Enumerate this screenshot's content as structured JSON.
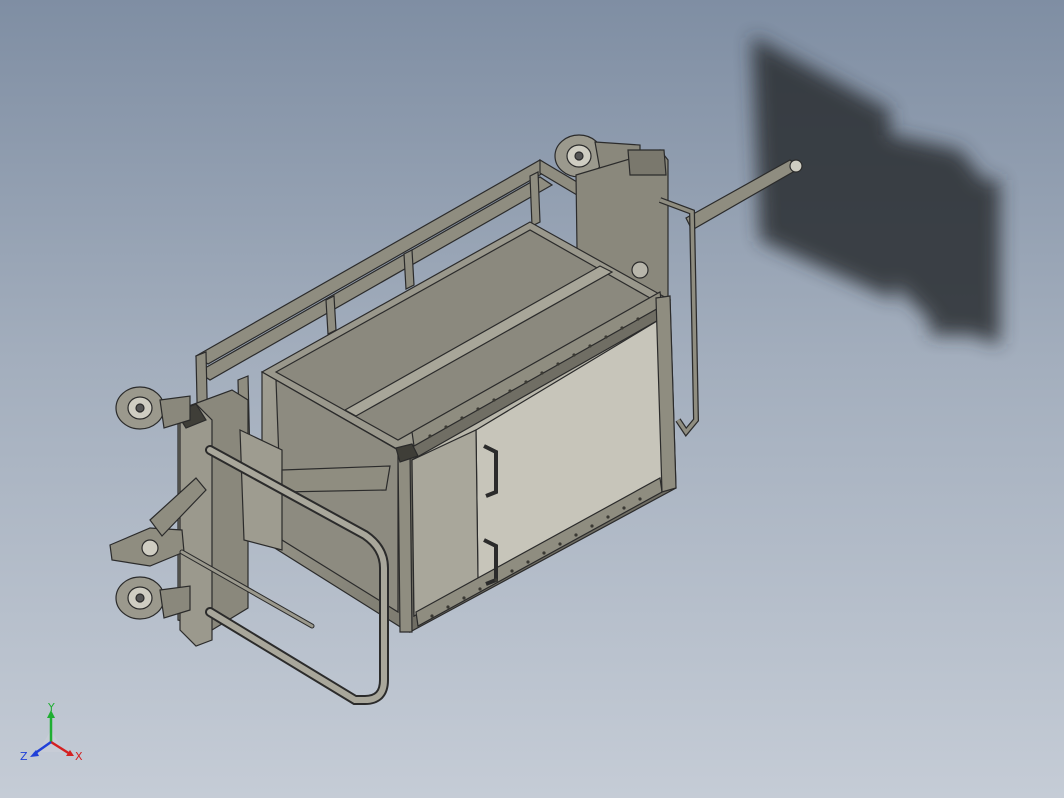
{
  "viewport": {
    "background_top": "#7f8ea3",
    "background_bottom": "#c5ccd6"
  },
  "model": {
    "body_color": "#8f8d80",
    "edge_color": "#2b2b2b",
    "interior_color": "#b7b5aa",
    "shadow_color": "#2a2d33"
  },
  "triad": {
    "x_label": "X",
    "y_label": "Y",
    "z_label": "Z",
    "x_color": "#d42020",
    "y_color": "#1fae32",
    "z_color": "#2040d8"
  }
}
